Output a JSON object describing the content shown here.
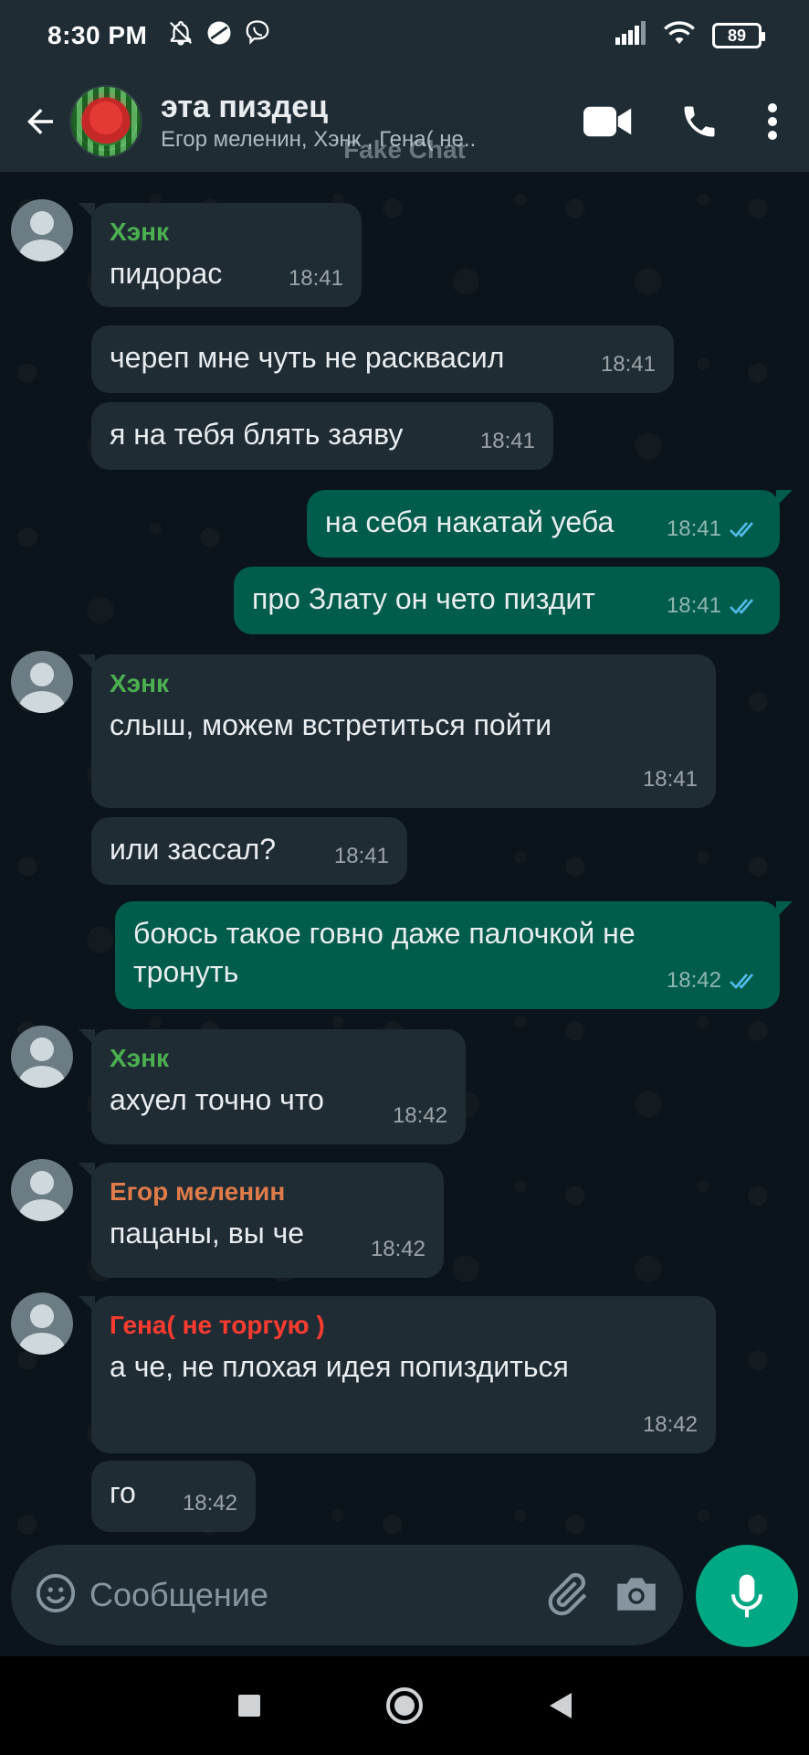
{
  "status_bar": {
    "time": "8:30 PM",
    "battery": "89"
  },
  "header": {
    "title": "эта пиздец",
    "subtitle": "Егор меленин, Хэнк , Гена( не..",
    "watermark": "Fake Chat"
  },
  "colors": {
    "sender_hank": "#4caf50",
    "sender_egor": "#e07b4a",
    "sender_gena": "#ff3b30",
    "outgoing_bubble": "#005c4b",
    "incoming_bubble": "#1f2c34",
    "read_ticks": "#53bdeb",
    "mic_button": "#00a884"
  },
  "messages": [
    {
      "dir": "in",
      "sender": "Хэнк",
      "text": "пидорас",
      "time": "18:41"
    },
    {
      "dir": "in",
      "text": "череп мне чуть не расквасил",
      "time": "18:41"
    },
    {
      "dir": "in",
      "text": "я на тебя блять заяву",
      "time": "18:41"
    },
    {
      "dir": "out",
      "text": "на себя накатай уеба",
      "time": "18:41"
    },
    {
      "dir": "out",
      "text": "про Злату он чето пиздит",
      "time": "18:41"
    },
    {
      "dir": "in",
      "sender": "Хэнк",
      "text": "слыш, можем встретиться пойти",
      "time": "18:41"
    },
    {
      "dir": "in",
      "text": "или зассал?",
      "time": "18:41"
    },
    {
      "dir": "out",
      "text": "боюсь такое говно даже палочкой не тронуть",
      "time": "18:42"
    },
    {
      "dir": "in",
      "sender": "Хэнк",
      "text": "ахуел точно что",
      "time": "18:42"
    },
    {
      "dir": "in",
      "sender": "Егор меленин",
      "text": "пацаны, вы че",
      "time": "18:42"
    },
    {
      "dir": "in",
      "sender": "Гена( не торгую )",
      "text": "а че, не плохая идея попиздиться",
      "time": "18:42"
    },
    {
      "dir": "in",
      "text": "го",
      "time": "18:42"
    }
  ],
  "composer": {
    "placeholder": "Сообщение"
  }
}
